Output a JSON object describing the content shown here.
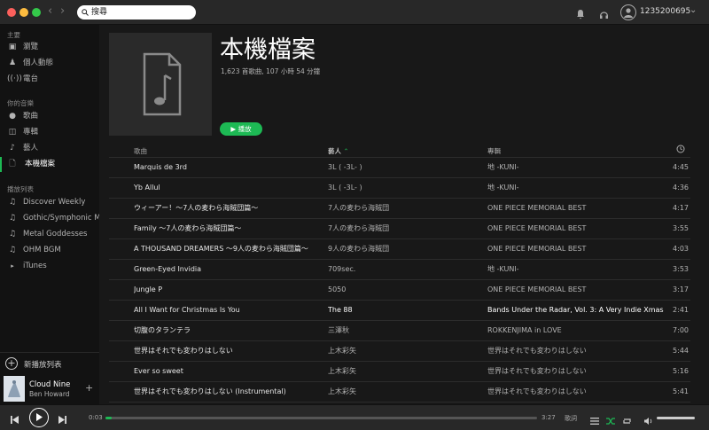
{
  "titlebar": {
    "search_value": "搜尋",
    "username": "1235200695"
  },
  "sidebar": {
    "main_heading": "主要",
    "main_items": [
      {
        "label": "瀏覽",
        "icon": "browse-icon"
      },
      {
        "label": "個人動態",
        "icon": "activity-icon"
      },
      {
        "label": "電台",
        "icon": "radio-icon"
      }
    ],
    "music_heading": "你的音樂",
    "music_items": [
      {
        "label": "歌曲",
        "icon": "songs-icon"
      },
      {
        "label": "專輯",
        "icon": "albums-icon"
      },
      {
        "label": "藝人",
        "icon": "artists-icon"
      },
      {
        "label": "本機檔案",
        "icon": "local-files-icon"
      }
    ],
    "playlist_heading": "播放列表",
    "playlists": [
      {
        "label": "Discover Weekly"
      },
      {
        "label": "Gothic/Symphonic Metal"
      },
      {
        "label": "Metal Goddesses"
      },
      {
        "label": "OHM BGM"
      },
      {
        "label": "iTunes"
      }
    ],
    "new_playlist": "新播放列表",
    "now_playing": {
      "title": "Cloud Nine",
      "artist": "Ben Howard"
    }
  },
  "main": {
    "title": "本機檔案",
    "meta": "1,623 首歌曲, 107 小時 54 分鐘",
    "play_label": "播放",
    "columns": {
      "song": "歌曲",
      "artist": "藝人",
      "album": "專輯"
    },
    "rows": [
      {
        "song": "Marquis de 3rd",
        "artist": "3L ( -3L- )",
        "album": "地 -KUNI-",
        "time": "4:45"
      },
      {
        "song": "Yb Allul",
        "artist": "3L ( -3L- )",
        "album": "地 -KUNI-",
        "time": "4:36"
      },
      {
        "song": "ウィーアー！～7人の麦わら海賊団篇～",
        "artist": "7人の麦わら海賊団",
        "album": "ONE PIECE MEMORIAL BEST",
        "time": "4:17"
      },
      {
        "song": "Family ～7人の麦わら海賊団篇～",
        "artist": "7人の麦わら海賊団",
        "album": "ONE PIECE MEMORIAL BEST",
        "time": "3:55"
      },
      {
        "song": "A THOUSAND DREAMERS ～9人の麦わら海賊団篇～",
        "artist": "9人の麦わら海賊団",
        "album": "ONE PIECE MEMORIAL BEST",
        "time": "4:03"
      },
      {
        "song": "Green-Eyed Invidia",
        "artist": "709sec.",
        "album": "地 -KUNI-",
        "time": "3:53"
      },
      {
        "song": "Jungle P",
        "artist": "5050",
        "album": "ONE PIECE MEMORIAL BEST",
        "time": "3:17"
      },
      {
        "song": "All I Want for Christmas Is You",
        "artist": "The 88",
        "album": "Bands Under the Radar, Vol. 3: A Very Indie Xmas",
        "time": "2:41"
      },
      {
        "song": "切腹のタランテラ",
        "artist": "三澤秋",
        "album": "ROKKENJIMA in LOVE",
        "time": "7:00"
      },
      {
        "song": "世界はそれでも変わりはしない",
        "artist": "上木彩矢",
        "album": "世界はそれでも変わりはしない",
        "time": "5:44"
      },
      {
        "song": "Ever so sweet",
        "artist": "上木彩矢",
        "album": "世界はそれでも変わりはしない",
        "time": "5:16"
      },
      {
        "song": "世界はそれでも変わりはしない (Instrumental)",
        "artist": "上木彩矢",
        "album": "世界はそれでも変わりはしない",
        "time": "5:41"
      }
    ]
  },
  "player": {
    "elapsed": "0:03",
    "duration": "3:27",
    "progress": 0.015,
    "lyrics_label": "歌詞",
    "volume": 1.0
  },
  "colors": {
    "accent": "#1db954",
    "background": "#181818",
    "sidebar": "#121212",
    "bar": "#282828"
  }
}
